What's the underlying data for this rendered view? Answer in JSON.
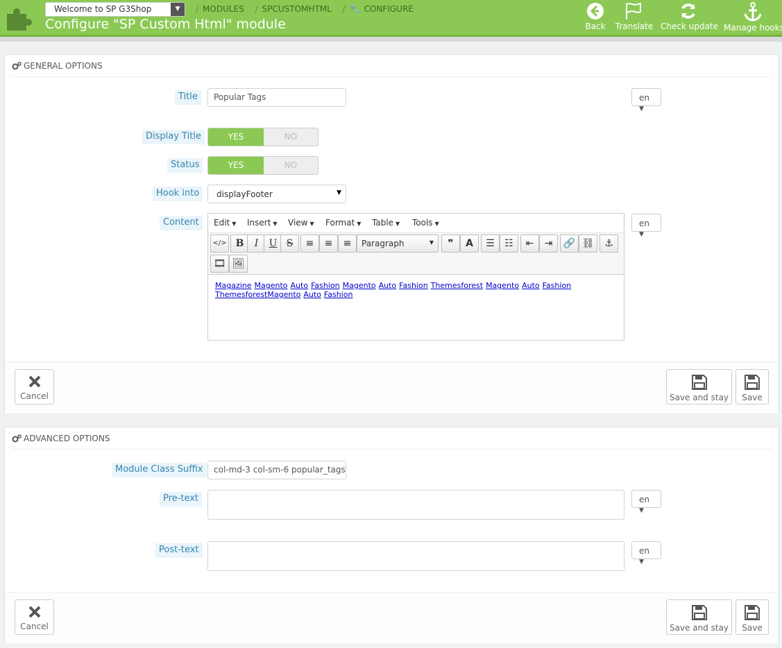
{
  "header": {
    "shop_select": "Welcome to SP G3Shop",
    "breadcrumb": [
      "MODULES",
      "SPCUSTOMHTML",
      "CONFIGURE"
    ],
    "title": "Configure \"SP Custom Html\" module",
    "toolbar": [
      {
        "label": "Back",
        "icon": "back-arrow-icon"
      },
      {
        "label": "Translate",
        "icon": "flag-icon"
      },
      {
        "label": "Check update",
        "icon": "refresh-icon"
      },
      {
        "label": "Manage hooks",
        "icon": "anchor-icon"
      }
    ]
  },
  "general": {
    "heading": "GENERAL OPTIONS",
    "title_label": "Title",
    "title_value": "Popular Tags",
    "lang": "en",
    "display_title_label": "Display Title",
    "status_label": "Status",
    "yes": "YES",
    "no": "NO",
    "hook_label": "Hook into",
    "hook_value": "displayFooter",
    "content_label": "Content",
    "menu": [
      "Edit",
      "Insert",
      "View",
      "Format",
      "Table",
      "Tools"
    ],
    "format_value": "Paragraph",
    "content_links": [
      "Magazine",
      "Magento",
      "Auto",
      "Fashion",
      "Magento",
      "Auto",
      "Fashion",
      "Themesforest",
      "Magento",
      "Auto",
      "Fashion",
      "ThemesforestMagento",
      "Auto",
      "Fashion"
    ]
  },
  "advanced": {
    "heading": "ADVANCED OPTIONS",
    "suffix_label": "Module Class Suffix",
    "suffix_value": "col-md-3 col-sm-6 popular_tags",
    "pretext_label": "Pre-text",
    "posttext_label": "Post-text",
    "lang": "en"
  },
  "buttons": {
    "cancel": "Cancel",
    "save_stay": "Save and stay",
    "save": "Save"
  },
  "colors": {
    "header_green": "#8bc954",
    "label_blue": "#3586ae",
    "link_blue": "#0000cc"
  }
}
